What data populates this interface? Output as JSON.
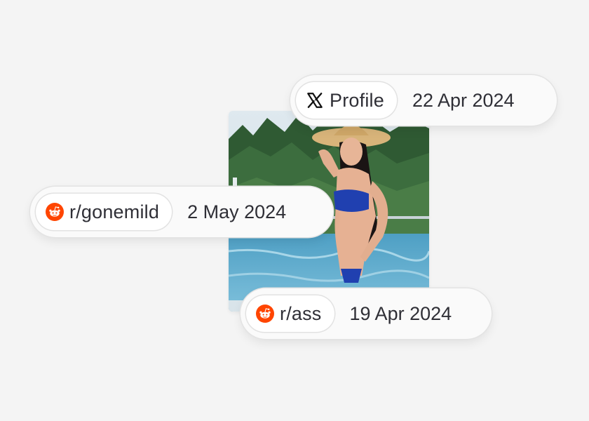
{
  "colors": {
    "background": "#f4f4f4",
    "reddit_orange": "#ff4500",
    "text": "#2f2f36",
    "x_logo": "#111111"
  },
  "photo": {
    "icon": "photo-thumbnail"
  },
  "badges": [
    {
      "source": "x-logo-icon",
      "label": "Profile",
      "date": "22 Apr 2024"
    },
    {
      "source": "reddit-icon",
      "label": "r/gonemild",
      "date": "2 May 2024"
    },
    {
      "source": "reddit-icon",
      "label": "r/ass",
      "date": "19 Apr 2024"
    }
  ]
}
